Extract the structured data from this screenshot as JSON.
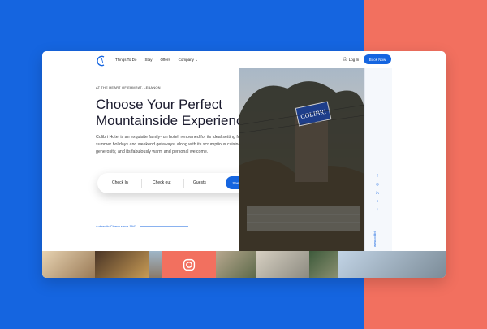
{
  "header": {
    "nav": [
      "Things To Do",
      "Stay",
      "Offers",
      "Company"
    ],
    "login": "Log In",
    "book_now": "Book Now"
  },
  "hero": {
    "kicker": "AT THE HEART OF EHMRAT, LEBANON",
    "headline": "Choose Your Perfect Mountainside Experience",
    "description": "Colibri Hotel is an exquisite family-run hotel, renowned for its ideal setting for summer holidays and weekend getaways, along with its scrumptious cuisine, generosity, and its fabulously warm and personal welcome."
  },
  "search": {
    "checkin": "Check In",
    "checkout": "Check out",
    "guests": "Guests",
    "button": "See Availability"
  },
  "tagline": "Authentic Charm since 1943",
  "side": {
    "url": "www.colibri",
    "icons": [
      "f",
      "◎",
      "in",
      "t"
    ]
  },
  "colors": {
    "accent": "#1565e0",
    "coral": "#f2705f"
  }
}
